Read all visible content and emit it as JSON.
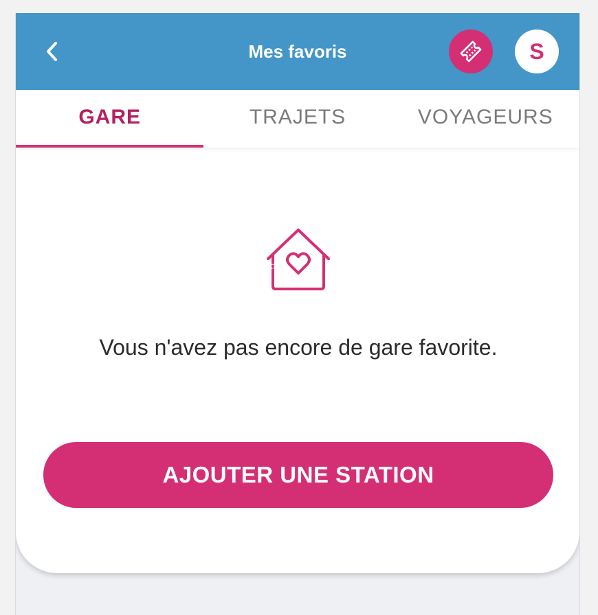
{
  "header": {
    "title": "Mes favoris",
    "back_icon": "chevron-left-icon",
    "ticket_icon": "ticket-icon",
    "avatar_initial": "S",
    "background_color": "#4396c7",
    "accent_color": "#d42f74"
  },
  "tabs": [
    {
      "label": "GARE",
      "active": true
    },
    {
      "label": "TRAJETS",
      "active": false
    },
    {
      "label": "VOYAGEURS",
      "active": false
    }
  ],
  "empty_state": {
    "icon": "house-heart-icon",
    "message": "Vous n'avez pas encore de gare favorite.",
    "button_label": "AJOUTER UNE STATION"
  }
}
